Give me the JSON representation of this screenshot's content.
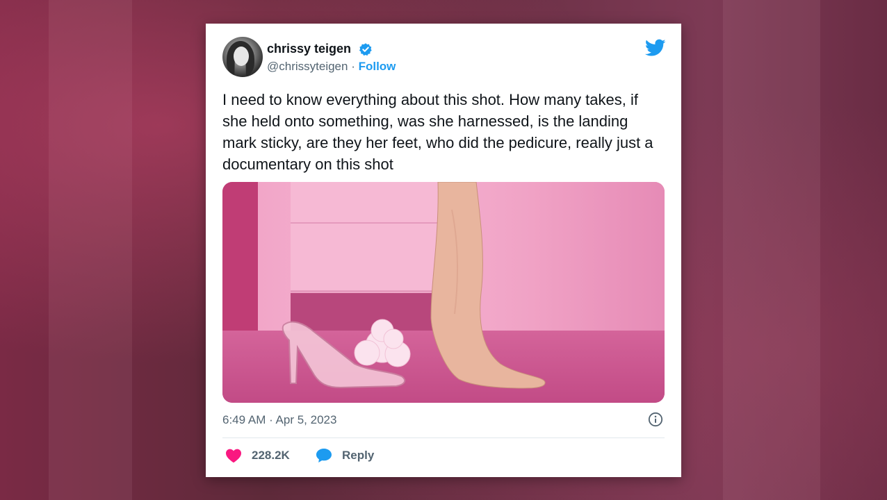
{
  "tweet": {
    "author_name": "chrissy teigen",
    "author_handle": "@chrissyteigen",
    "separator": " · ",
    "follow_label": "Follow",
    "text": "I need to know everything about this shot. How many takes, if she held onto something, was she harnessed, is the landing mark sticky, are they her feet, who did the pedicure, really just a documentary on this shot",
    "timestamp": "6:49 AM · Apr 5, 2023",
    "like_count": "228.2K",
    "reply_label": "Reply"
  },
  "icons": {
    "verified": "verified-badge-icon",
    "platform": "twitter-bird-icon",
    "info": "info-icon",
    "like": "heart-icon",
    "reply": "speech-bubble-icon"
  },
  "colors": {
    "brand_blue": "#1d9bf0",
    "like_pink": "#f91880",
    "text_primary": "#0f1419",
    "text_secondary": "#536471"
  }
}
